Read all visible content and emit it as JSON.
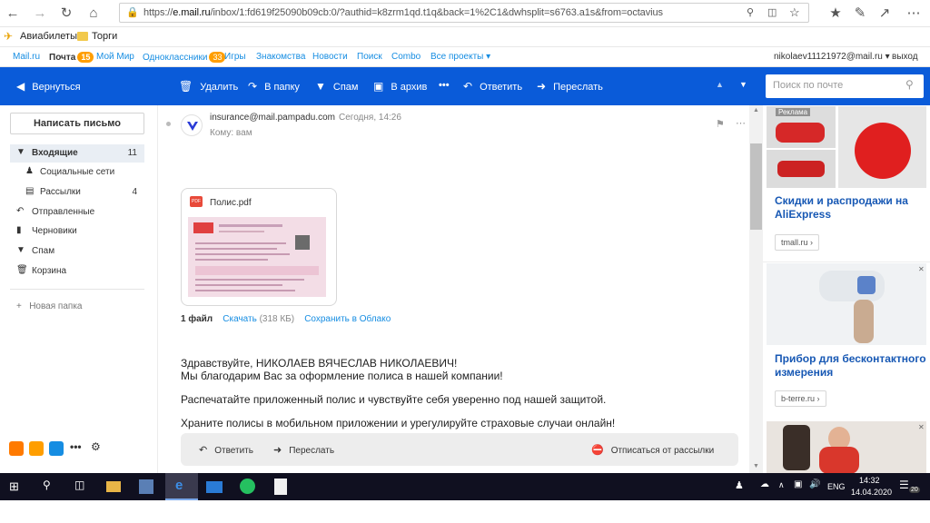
{
  "browser": {
    "url_prefix": "https://",
    "url_host": "e.mail.ru",
    "url_rest": "/inbox/1:fd619f25090b09cb:0/?authid=k8zrm1qd.t1q&back=1%2C1&dwhsplit=s6763.a1s&from=octavius",
    "bookmarks": [
      "Авиабилеты",
      "Торги"
    ]
  },
  "topline": {
    "items": [
      "Mail.ru",
      "Почта",
      "Мой Мир",
      "Одноклассники",
      "Игры",
      "Знакомства",
      "Новости",
      "Поиск",
      "Combo",
      "Все проекты"
    ],
    "mail_badge": "15",
    "ok_badge": "33",
    "user_email": "nikolaev11121972@mail.ru",
    "logout": "выход"
  },
  "toolbar": {
    "back": "Вернуться",
    "delete": "Удалить",
    "to_folder": "В папку",
    "spam": "Спам",
    "archive": "В архив",
    "reply": "Ответить",
    "forward": "Переслать",
    "search_placeholder": "Поиск по почте"
  },
  "sidebar": {
    "compose": "Написать письмо",
    "folders": [
      {
        "label": "Входящие",
        "count": "11"
      },
      {
        "label": "Социальные сети",
        "count": ""
      },
      {
        "label": "Рассылки",
        "count": "4"
      },
      {
        "label": "Отправленные",
        "count": ""
      },
      {
        "label": "Черновики",
        "count": ""
      },
      {
        "label": "Спам",
        "count": ""
      },
      {
        "label": "Корзина",
        "count": ""
      }
    ],
    "new_folder": "Новая папка"
  },
  "message": {
    "sender": "insurance@mail.pampadu.com",
    "date": "Сегодня, 14:26",
    "to": "Кому: вам",
    "attachment_name": "Полис.pdf",
    "files_count": "1 файл",
    "download": "Скачать",
    "size": "(318 КБ)",
    "save_cloud": "Сохранить в Облако",
    "body": [
      "Здравствуйте, НИКОЛАЕВ ВЯЧЕСЛАВ НИКОЛАЕВИЧ!",
      "Мы благодарим Вас за оформление полиса в нашей компании!",
      "Распечатайте приложенный полис и чувствуйте себя уверенно под нашей защитой.",
      "Храните полисы в мобильном приложении и урегулируйте страховые случаи онлайн!"
    ],
    "reply": "Ответить",
    "forward": "Переслать",
    "unsubscribe": "Отписаться от рассылки"
  },
  "ads": {
    "label": "Реклама",
    "items": [
      {
        "title": "Скидки и распродажи на AliExpress",
        "domain": "tmall.ru"
      },
      {
        "title": "Прибор для бесконтактного измерения",
        "domain": "b-terre.ru"
      }
    ]
  },
  "taskbar": {
    "lang": "ENG",
    "time": "14:32",
    "date": "14.04.2020",
    "notif": "20"
  },
  "colors": {
    "toolbar_bg": "#0a5bd9",
    "link": "#168de2",
    "ad_title": "#1758b4",
    "badge": "#ff9e00",
    "taskbar": "#101020"
  }
}
